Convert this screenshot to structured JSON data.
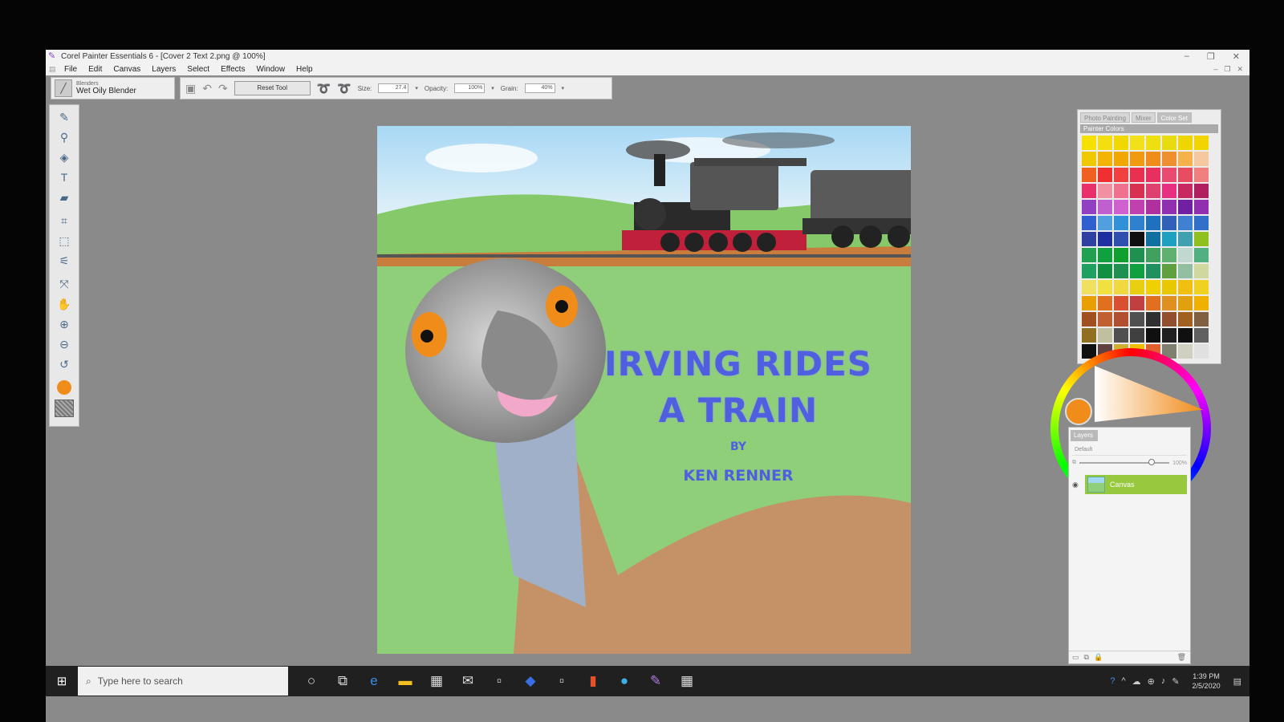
{
  "window": {
    "title": "Corel Painter Essentials 6 - [Cover 2 Text 2.png @ 100%]",
    "controls": [
      "–",
      "❐",
      "✕"
    ]
  },
  "menu": [
    "File",
    "Edit",
    "Canvas",
    "Layers",
    "Select",
    "Effects",
    "Window",
    "Help"
  ],
  "brush": {
    "category": "Blenders",
    "variant": "Wet Oily Blender"
  },
  "property_bar": {
    "reset_label": "Reset Tool",
    "size_label": "Size:",
    "size_value": "27.4",
    "opacity_label": "Opacity:",
    "opacity_value": "100%",
    "grain_label": "Grain:",
    "grain_value": "40%"
  },
  "tools": [
    "brush-icon",
    "dropper-icon",
    "fill-icon",
    "text-icon",
    "eraser-icon",
    "crop-icon",
    "rectangle-select-icon",
    "magic-wand-icon",
    "transform-icon",
    "grabber-icon",
    "zoom-in-icon",
    "zoom-out-icon",
    "rotate-icon"
  ],
  "main_color": "#f08c1a",
  "artwork": {
    "title_line1": "IRVING RIDES",
    "title_line2": "A TRAIN",
    "by": "BY",
    "author": "KEN RENNER",
    "title_color": "#4f5fe0"
  },
  "color_panel": {
    "tabs": [
      "Photo Painting",
      "Mixer",
      "Color Set"
    ],
    "active_tab": "Color Set",
    "library_name": "Painter Colors",
    "swatches": [
      "#f5e000",
      "#f3de10",
      "#f0d800",
      "#f2e01a",
      "#eee010",
      "#e8dc10",
      "#f0d600",
      "#f2d500",
      "#f0c800",
      "#f2b400",
      "#f0a800",
      "#f09a10",
      "#f08c1a",
      "#ef9030",
      "#f5b24a",
      "#f5c8a0",
      "#f06020",
      "#f03030",
      "#f04040",
      "#ea3050",
      "#e83060",
      "#e84a70",
      "#e84c60",
      "#f08080",
      "#e8306a",
      "#f090a0",
      "#f07090",
      "#d83050",
      "#e04070",
      "#e83080",
      "#c82860",
      "#b02060",
      "#9040c0",
      "#c060d0",
      "#d060d0",
      "#c040b0",
      "#b030a0",
      "#9030b0",
      "#7020a0",
      "#9030b0",
      "#3060d0",
      "#50a0e0",
      "#3090d8",
      "#3080d0",
      "#2070c0",
      "#3060b8",
      "#4080d0",
      "#3070c8",
      "#3040a0",
      "#2030a0",
      "#3050b0",
      "#101010",
      "#1070a0",
      "#20a0c0",
      "#40a0b0",
      "#90c020",
      "#20a050",
      "#10a040",
      "#10a030",
      "#209050",
      "#40a060",
      "#60b070",
      "#c0d8d0",
      "#50b080",
      "#20a060",
      "#109040",
      "#209050",
      "#10a040",
      "#209060",
      "#60a040",
      "#90c0a0",
      "#d0d8a0",
      "#f0e060",
      "#f0e040",
      "#f0d840",
      "#e8d010",
      "#f0d000",
      "#e8c800",
      "#f0c010",
      "#f0d020",
      "#e8a000",
      "#e07020",
      "#d85030",
      "#c04040",
      "#e07020",
      "#e09020",
      "#e0a010",
      "#f0b000",
      "#a05020",
      "#c06030",
      "#b05030",
      "#505050",
      "#303030",
      "#905030",
      "#a06020",
      "#806040",
      "#907020",
      "#c0c0a0",
      "#505050",
      "#404040",
      "#101010",
      "#202020",
      "#101010",
      "#606060",
      "#101010",
      "#604040",
      "#d0b030",
      "#f0c000",
      "#e06030",
      "#808070",
      "#d0d0c0",
      "#e0e0e0"
    ]
  },
  "layers_panel": {
    "tab": "Layers",
    "composite": "Default",
    "opacity": "100%",
    "layer_name": "Canvas"
  },
  "taskbar": {
    "search_placeholder": "Type here to search",
    "time": "1:39 PM",
    "date": "2/5/2020"
  }
}
